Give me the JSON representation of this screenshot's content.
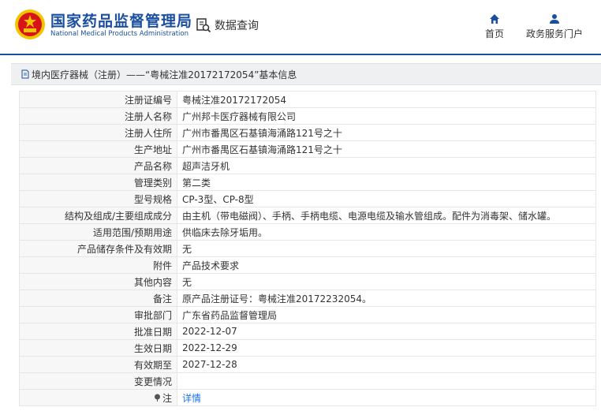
{
  "header": {
    "brand_cn": "国家药品监督管理局",
    "brand_en": "National Medical Products Administration",
    "data_query": "数据查询",
    "nav_home": "首页",
    "nav_gov": "政务服务门户"
  },
  "breadcrumb": {
    "text": "境内医疗器械（注册）——“粤械注准20172172054”基本信息"
  },
  "rows": [
    {
      "label": "注册证编号",
      "value": "粤械注准20172172054"
    },
    {
      "label": "注册人名称",
      "value": "广州邦卡医疗器械有限公司"
    },
    {
      "label": "注册人住所",
      "value": "广州市番禺区石基镇海涌路121号之十"
    },
    {
      "label": "生产地址",
      "value": "广州市番禺区石基镇海涌路121号之十"
    },
    {
      "label": "产品名称",
      "value": "超声洁牙机"
    },
    {
      "label": "管理类别",
      "value": "第二类"
    },
    {
      "label": "型号规格",
      "value": "CP-3型、CP-8型"
    },
    {
      "label": "结构及组成/主要组成成分",
      "value": "由主机（带电磁阀）、手柄、手柄电缆、电源电缆及输水管组成。配件为消毒架、储水罐。"
    },
    {
      "label": "适用范围/预期用途",
      "value": "供临床去除牙垢用。"
    },
    {
      "label": "产品储存条件及有效期",
      "value": "无"
    },
    {
      "label": "附件",
      "value": "产品技术要求"
    },
    {
      "label": "其他内容",
      "value": "无"
    },
    {
      "label": "备注",
      "value": "原产品注册证号：粤械注准20172232054。"
    },
    {
      "label": "审批部门",
      "value": "广东省药品监督管理局"
    },
    {
      "label": "批准日期",
      "value": "2022-12-07"
    },
    {
      "label": "生效日期",
      "value": "2022-12-29"
    },
    {
      "label": "有效期至",
      "value": "2027-12-28"
    },
    {
      "label": "变更情况",
      "value": ""
    }
  ],
  "note_row": {
    "label": "注",
    "link": "详情"
  },
  "colors": {
    "brand_blue": "#1a4e9f",
    "link_blue": "#1a73e8",
    "emblem_red": "#d7141a",
    "emblem_gold": "#f5c400"
  }
}
